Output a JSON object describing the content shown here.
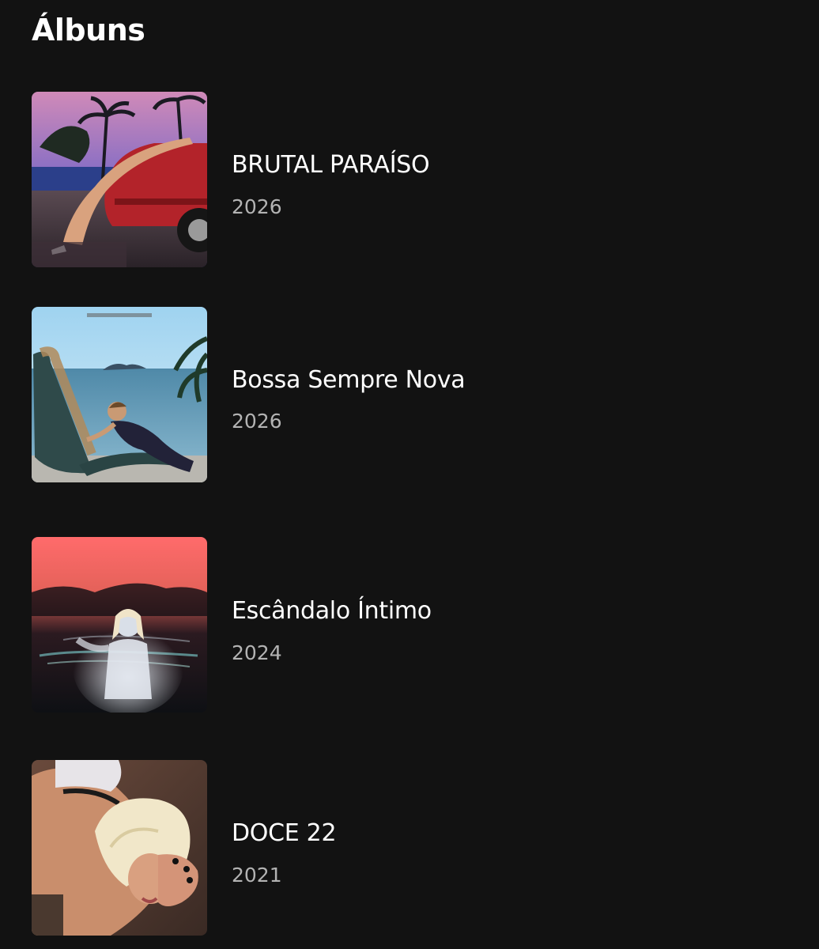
{
  "section": {
    "title": "Álbuns"
  },
  "albums": [
    {
      "title": "BRUTAL PARAÍSO",
      "year": "2026",
      "cover_icon": "album-cover-brutal-paraiso"
    },
    {
      "title": "Bossa Sempre Nova",
      "year": "2026",
      "cover_icon": "album-cover-bossa-sempre-nova"
    },
    {
      "title": "Escândalo Íntimo",
      "year": "2024",
      "cover_icon": "album-cover-escandalo-intimo"
    },
    {
      "title": "DOCE 22",
      "year": "2021",
      "cover_icon": "album-cover-doce-22"
    }
  ],
  "colors": {
    "background": "#121212",
    "title_text": "#ffffff",
    "year_text": "#b3b3b3"
  }
}
